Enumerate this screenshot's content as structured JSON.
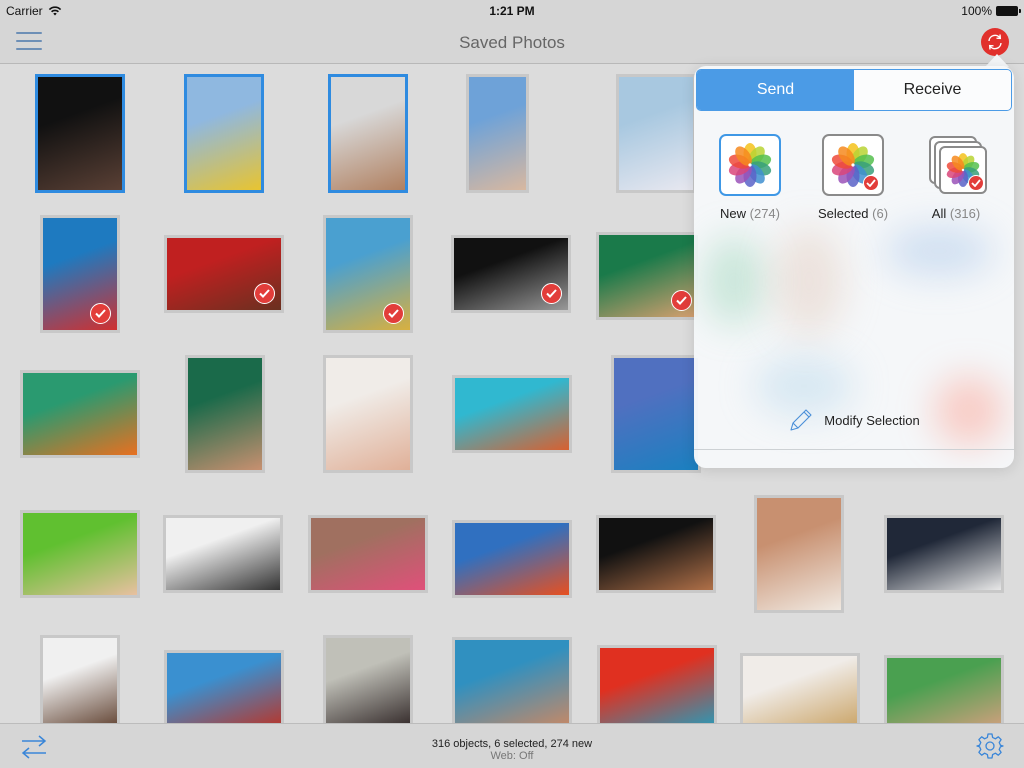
{
  "status_bar": {
    "carrier": "Carrier",
    "time": "1:21 PM",
    "battery": "100%"
  },
  "nav": {
    "title": "Saved Photos",
    "menu_icon": "hamburger-menu-icon",
    "sync_icon": "sync-icon"
  },
  "photos": [
    {
      "name": "woman-black-cap",
      "frame": "blue",
      "check": false,
      "colors": [
        "#111111",
        "#5a4035"
      ]
    },
    {
      "name": "child-duck-float",
      "frame": "blue",
      "check": false,
      "colors": [
        "#8fb8e0",
        "#e8c430"
      ]
    },
    {
      "name": "dog-sunglasses",
      "frame": "blue",
      "check": false,
      "colors": [
        "#d8d8d8",
        "#b08060"
      ]
    },
    {
      "name": "girl-dandelion",
      "frame": "none",
      "check": false,
      "colors": [
        "#6ea2d8",
        "#d8b8a0"
      ]
    },
    {
      "name": "man-smiling-beach",
      "frame": "none",
      "check": false,
      "colors": [
        "#a8c8e0",
        "#e8e8f0"
      ]
    },
    {
      "name": "woman-milk-glass",
      "frame": "none",
      "check": true,
      "colors": [
        "#1e7ac0",
        "#d03030"
      ]
    },
    {
      "name": "woman-covering-face-red",
      "frame": "none",
      "check": true,
      "colors": [
        "#c02020",
        "#6a3020"
      ]
    },
    {
      "name": "starfish-beach",
      "frame": "none",
      "check": true,
      "colors": [
        "#4aa0d0",
        "#d8b040"
      ]
    },
    {
      "name": "woman-black-white",
      "frame": "none",
      "check": true,
      "colors": [
        "#111111",
        "#999999"
      ]
    },
    {
      "name": "woman-surprised-green",
      "frame": "none",
      "check": true,
      "colors": [
        "#1a7a4a",
        "#d8a070"
      ]
    },
    {
      "name": "clownfish-anemone",
      "frame": "none",
      "check": false,
      "colors": [
        "#2a9a70",
        "#e87020"
      ]
    },
    {
      "name": "woman-green-backdrop",
      "frame": "none",
      "check": false,
      "colors": [
        "#1a6a4a",
        "#c89070"
      ]
    },
    {
      "name": "baby-white-bonnet",
      "frame": "none",
      "check": false,
      "colors": [
        "#f0ece8",
        "#e0b098"
      ]
    },
    {
      "name": "girl-snorkel-starfish",
      "frame": "none",
      "check": false,
      "colors": [
        "#30b8d0",
        "#d86030"
      ]
    },
    {
      "name": "blue-misty-rocks",
      "frame": "none",
      "check": false,
      "colors": [
        "#5070c0",
        "#1a80c0"
      ]
    },
    {
      "name": "baby-green-towel",
      "frame": "none",
      "check": false,
      "colors": [
        "#60c030",
        "#e8c0a0"
      ]
    },
    {
      "name": "dalmatian-puppy",
      "frame": "none",
      "check": false,
      "colors": [
        "#f0f0f0",
        "#333333"
      ]
    },
    {
      "name": "eyes-pink-fan",
      "frame": "none",
      "check": false,
      "colors": [
        "#a07060",
        "#e0507a"
      ]
    },
    {
      "name": "water-drops-flower",
      "frame": "none",
      "check": false,
      "colors": [
        "#3070c0",
        "#e85020"
      ]
    },
    {
      "name": "man-beanie-shirtless",
      "frame": "none",
      "check": false,
      "colors": [
        "#111111",
        "#b07048"
      ]
    },
    {
      "name": "woman-daisy",
      "frame": "none",
      "check": false,
      "colors": [
        "#c89070",
        "#f0e8e0"
      ]
    },
    {
      "name": "crosswalk-shadows",
      "frame": "none",
      "check": false,
      "colors": [
        "#202838",
        "#e8e8e8"
      ]
    },
    {
      "name": "woman-short-hair",
      "frame": "none",
      "check": false,
      "colors": [
        "#f0f0f0",
        "#5a3a28"
      ]
    },
    {
      "name": "golden-gate-bridge",
      "frame": "none",
      "check": false,
      "colors": [
        "#3a90d0",
        "#c03020"
      ]
    },
    {
      "name": "man-dark-hair",
      "frame": "none",
      "check": false,
      "colors": [
        "#c0c0b8",
        "#2a2020"
      ]
    },
    {
      "name": "swimsuit-snorkel",
      "frame": "none",
      "check": false,
      "colors": [
        "#3090c0",
        "#d08860"
      ]
    },
    {
      "name": "macaw-parrots",
      "frame": "none",
      "check": false,
      "colors": [
        "#e03020",
        "#20a0c0"
      ]
    },
    {
      "name": "woman-curly-blonde",
      "frame": "none",
      "check": false,
      "colors": [
        "#f0ece8",
        "#c8a060"
      ]
    },
    {
      "name": "woman-hands-face-green",
      "frame": "none",
      "check": false,
      "colors": [
        "#4aa050",
        "#d8a080"
      ]
    }
  ],
  "popover": {
    "tabs": [
      {
        "label": "Send",
        "active": true
      },
      {
        "label": "Receive",
        "active": false
      }
    ],
    "options": [
      {
        "label": "New",
        "count": "(274)",
        "icon": "photos-flower-icon",
        "active": true
      },
      {
        "label": "Selected",
        "count": "(6)",
        "icon": "photos-flower-checked-icon",
        "active": false
      },
      {
        "label": "All",
        "count": "(316)",
        "icon": "photos-stack-icon",
        "active": false
      }
    ],
    "modify_label": "Modify Selection",
    "modify_icon": "pencil-icon"
  },
  "toolbar": {
    "summary": "316 objects, 6 selected, 274 new",
    "web_status": "Web: Off",
    "swap_icon": "transfer-arrows-icon",
    "settings_icon": "gear-icon"
  },
  "colors": {
    "accent": "#4b9be6",
    "sync_red": "#e1302c",
    "check_red": "#e23d3a",
    "selection_blue": "#2f8be0"
  }
}
